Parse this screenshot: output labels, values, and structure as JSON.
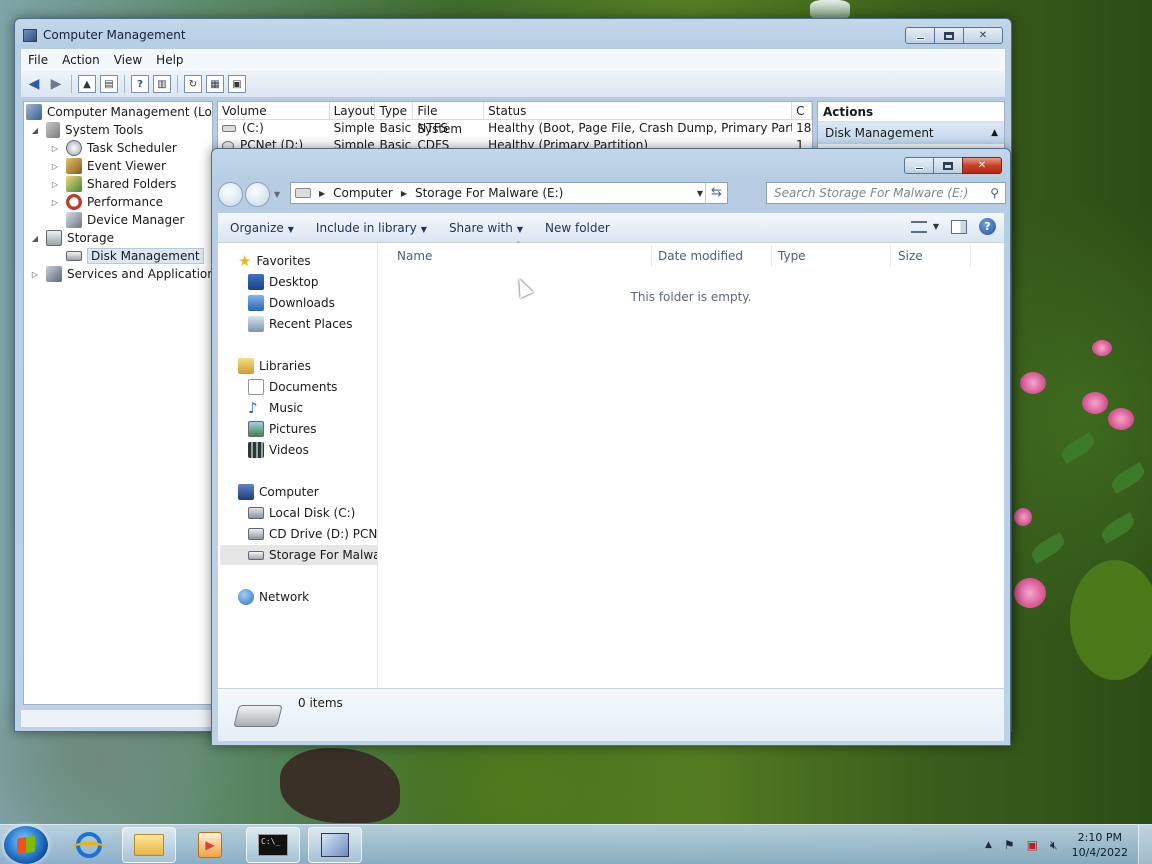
{
  "computer_management": {
    "title": "Computer Management",
    "menu": [
      "File",
      "Action",
      "View",
      "Help"
    ],
    "tree": {
      "root": "Computer Management (Local",
      "system_tools": "System Tools",
      "task_scheduler": "Task Scheduler",
      "event_viewer": "Event Viewer",
      "shared_folders": "Shared Folders",
      "performance": "Performance",
      "device_manager": "Device Manager",
      "storage": "Storage",
      "disk_management": "Disk Management",
      "services": "Services and Applications"
    },
    "volume_columns": [
      "Volume",
      "Layout",
      "Type",
      "File System",
      "Status",
      "C"
    ],
    "volumes": [
      {
        "volume": "(C:)",
        "layout": "Simple",
        "type": "Basic",
        "fs": "NTFS",
        "status": "Healthy (Boot, Page File, Crash Dump, Primary Partition)",
        "cap": "18"
      },
      {
        "volume": "PCNet (D:)",
        "layout": "Simple",
        "type": "Basic",
        "fs": "CDFS",
        "status": "Healthy (Primary Partition)",
        "cap": "1"
      }
    ],
    "actions_header": "Actions",
    "actions_item": "Disk Management"
  },
  "explorer": {
    "breadcrumb": [
      "Computer",
      "Storage For Malware (E:)"
    ],
    "search_placeholder": "Search Storage For Malware (E:)",
    "commands": {
      "organize": "Organize",
      "include": "Include in library",
      "share": "Share with",
      "new_folder": "New folder"
    },
    "nav": {
      "favorites": "Favorites",
      "desktop": "Desktop",
      "downloads": "Downloads",
      "recent": "Recent Places",
      "libraries": "Libraries",
      "documents": "Documents",
      "music": "Music",
      "pictures": "Pictures",
      "videos": "Videos",
      "computer": "Computer",
      "local_disk": "Local Disk (C:)",
      "cd_drive": "CD Drive (D:) PCNet",
      "storage": "Storage For Malware",
      "network": "Network"
    },
    "columns": {
      "name": "Name",
      "date": "Date modified",
      "type": "Type",
      "size": "Size"
    },
    "empty_text": "This folder is empty.",
    "item_count": "0 items"
  },
  "taskbar": {
    "time": "2:10 PM",
    "date": "10/4/2022",
    "cmd_text": "C:\\_"
  }
}
